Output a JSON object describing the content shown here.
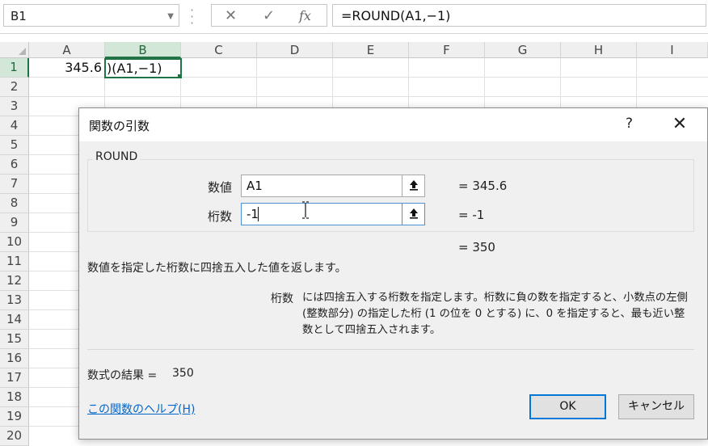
{
  "formula_bar": {
    "name_box": "B1",
    "cancel_icon": "✕",
    "enter_icon": "✓",
    "fx_icon": "fx",
    "formula": "=ROUND(A1,−1)"
  },
  "sheet": {
    "columns": [
      "A",
      "B",
      "C",
      "D",
      "E",
      "F",
      "G",
      "H",
      "I"
    ],
    "rows": [
      "1",
      "2",
      "3",
      "4",
      "5",
      "6",
      "7",
      "8",
      "9",
      "10",
      "11",
      "12",
      "13",
      "14",
      "15",
      "16",
      "17",
      "18",
      "19",
      "20"
    ],
    "selected_column": "B",
    "selected_row": "1",
    "cells": {
      "A1": "345.6",
      "B1": ")(A1,−1)"
    }
  },
  "dialog": {
    "title": "関数の引数",
    "help_button": "?",
    "close_button": "✕",
    "function_name": "ROUND",
    "args": [
      {
        "label": "数値",
        "value": "A1",
        "result": "=  345.6"
      },
      {
        "label": "桁数",
        "value": "-1",
        "result": "=  -1"
      }
    ],
    "formula_preview": "=  350",
    "description": "数値を指定した桁数に四捨五入した値を返します。",
    "arg_desc_name": "桁数",
    "arg_desc": "には四捨五入する桁数を指定します。桁数に負の数を指定すると、小数点の左側 (整数部分) の指定した桁 (1 の位を 0 とする) に、0 を指定すると、最も近い整数として四捨五入されます。",
    "result_label": "数式の結果 =",
    "result_value": "350",
    "help_link": "この関数のヘルプ(H)",
    "ok_label": "OK",
    "cancel_label": "キャンセル"
  }
}
